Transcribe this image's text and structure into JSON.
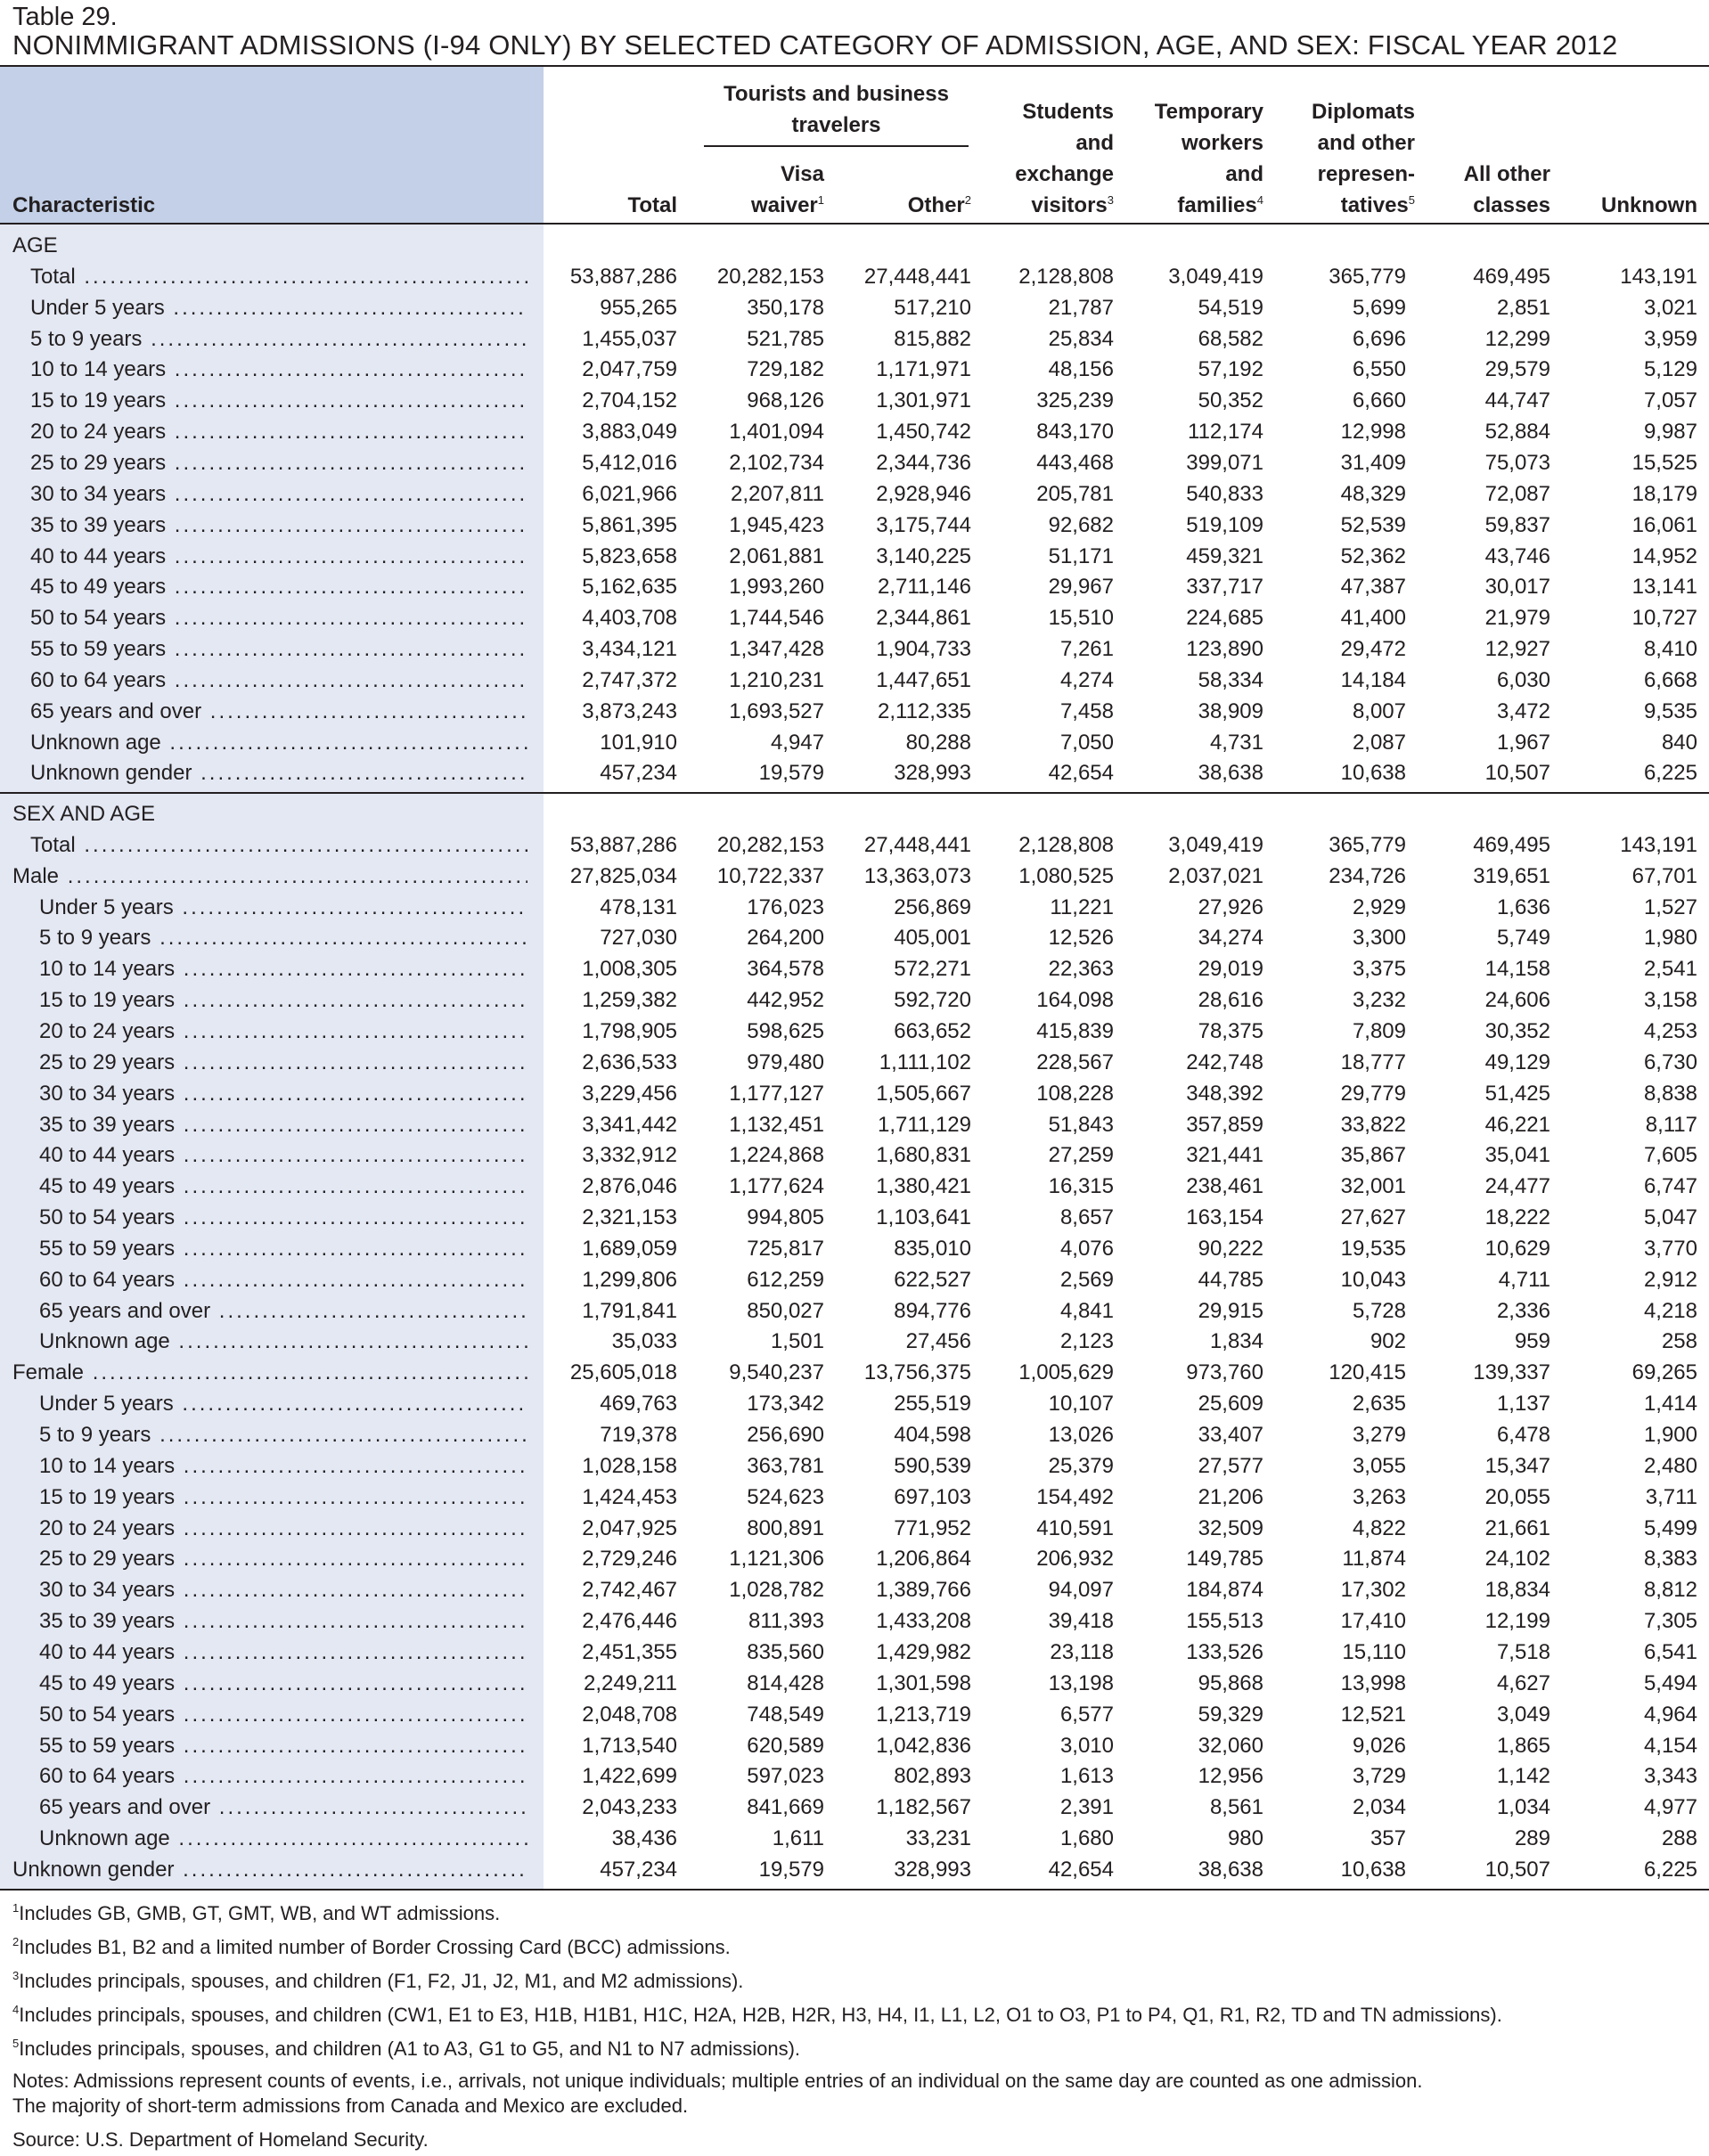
{
  "table_number": "Table 29.",
  "title": "NONIMMIGRANT ADMISSIONS (I-94 ONLY) BY SELECTED CATEGORY OF ADMISSION, AGE, AND SEX: FISCAL YEAR 2012",
  "header": {
    "characteristic": "Characteristic",
    "total": "Total",
    "tourists_group": [
      "Tourists and business",
      "travelers"
    ],
    "visa_waiver": {
      "line1": "Visa",
      "line2": "waiver",
      "note": "1"
    },
    "other": {
      "line1": "Other",
      "note": "2"
    },
    "students": {
      "lines": [
        "Students",
        "and",
        "exchange"
      ],
      "last": "visitors",
      "note": "3"
    },
    "temp_workers": {
      "lines": [
        "Temporary",
        "workers",
        "and"
      ],
      "last": "families",
      "note": "4"
    },
    "diplomats": {
      "lines": [
        "Diplomats",
        "and other",
        "represen-"
      ],
      "last": "tatives",
      "note": "5"
    },
    "all_other": {
      "lines": [
        "All other",
        "classes"
      ]
    },
    "unknown": "Unknown"
  },
  "rows": [
    {
      "label": "AGE",
      "section": true
    },
    {
      "label": "Total",
      "indent": 1,
      "v": [
        "53,887,286",
        "20,282,153",
        "27,448,441",
        "2,128,808",
        "3,049,419",
        "365,779",
        "469,495",
        "143,191"
      ]
    },
    {
      "label": "Under 5 years",
      "indent": 1,
      "v": [
        "955,265",
        "350,178",
        "517,210",
        "21,787",
        "54,519",
        "5,699",
        "2,851",
        "3,021"
      ]
    },
    {
      "label": "5 to 9 years",
      "indent": 1,
      "v": [
        "1,455,037",
        "521,785",
        "815,882",
        "25,834",
        "68,582",
        "6,696",
        "12,299",
        "3,959"
      ]
    },
    {
      "label": "10 to 14 years",
      "indent": 1,
      "v": [
        "2,047,759",
        "729,182",
        "1,171,971",
        "48,156",
        "57,192",
        "6,550",
        "29,579",
        "5,129"
      ]
    },
    {
      "label": "15 to 19 years",
      "indent": 1,
      "v": [
        "2,704,152",
        "968,126",
        "1,301,971",
        "325,239",
        "50,352",
        "6,660",
        "44,747",
        "7,057"
      ]
    },
    {
      "label": "20 to 24 years",
      "indent": 1,
      "v": [
        "3,883,049",
        "1,401,094",
        "1,450,742",
        "843,170",
        "112,174",
        "12,998",
        "52,884",
        "9,987"
      ]
    },
    {
      "label": "25 to 29 years",
      "indent": 1,
      "v": [
        "5,412,016",
        "2,102,734",
        "2,344,736",
        "443,468",
        "399,071",
        "31,409",
        "75,073",
        "15,525"
      ]
    },
    {
      "label": "30 to 34 years",
      "indent": 1,
      "v": [
        "6,021,966",
        "2,207,811",
        "2,928,946",
        "205,781",
        "540,833",
        "48,329",
        "72,087",
        "18,179"
      ]
    },
    {
      "label": "35 to 39 years",
      "indent": 1,
      "v": [
        "5,861,395",
        "1,945,423",
        "3,175,744",
        "92,682",
        "519,109",
        "52,539",
        "59,837",
        "16,061"
      ]
    },
    {
      "label": "40 to 44 years",
      "indent": 1,
      "v": [
        "5,823,658",
        "2,061,881",
        "3,140,225",
        "51,171",
        "459,321",
        "52,362",
        "43,746",
        "14,952"
      ]
    },
    {
      "label": "45 to 49 years",
      "indent": 1,
      "v": [
        "5,162,635",
        "1,993,260",
        "2,711,146",
        "29,967",
        "337,717",
        "47,387",
        "30,017",
        "13,141"
      ]
    },
    {
      "label": "50 to 54 years",
      "indent": 1,
      "v": [
        "4,403,708",
        "1,744,546",
        "2,344,861",
        "15,510",
        "224,685",
        "41,400",
        "21,979",
        "10,727"
      ]
    },
    {
      "label": "55 to 59 years",
      "indent": 1,
      "v": [
        "3,434,121",
        "1,347,428",
        "1,904,733",
        "7,261",
        "123,890",
        "29,472",
        "12,927",
        "8,410"
      ]
    },
    {
      "label": "60 to 64 years",
      "indent": 1,
      "v": [
        "2,747,372",
        "1,210,231",
        "1,447,651",
        "4,274",
        "58,334",
        "14,184",
        "6,030",
        "6,668"
      ]
    },
    {
      "label": "65 years and over",
      "indent": 1,
      "v": [
        "3,873,243",
        "1,693,527",
        "2,112,335",
        "7,458",
        "38,909",
        "8,007",
        "3,472",
        "9,535"
      ]
    },
    {
      "label": "Unknown age",
      "indent": 1,
      "v": [
        "101,910",
        "4,947",
        "80,288",
        "7,050",
        "4,731",
        "2,087",
        "1,967",
        "840"
      ]
    },
    {
      "label": "Unknown gender",
      "indent": 1,
      "v": [
        "457,234",
        "19,579",
        "328,993",
        "42,654",
        "38,638",
        "10,638",
        "10,507",
        "6,225"
      ]
    },
    {
      "label": "SEX AND AGE",
      "section": true
    },
    {
      "label": "Total",
      "indent": 1,
      "v": [
        "53,887,286",
        "20,282,153",
        "27,448,441",
        "2,128,808",
        "3,049,419",
        "365,779",
        "469,495",
        "143,191"
      ]
    },
    {
      "label": "Male",
      "indent": 0,
      "v": [
        "27,825,034",
        "10,722,337",
        "13,363,073",
        "1,080,525",
        "2,037,021",
        "234,726",
        "319,651",
        "67,701"
      ]
    },
    {
      "label": "Under 5 years",
      "indent": 2,
      "v": [
        "478,131",
        "176,023",
        "256,869",
        "11,221",
        "27,926",
        "2,929",
        "1,636",
        "1,527"
      ]
    },
    {
      "label": "5 to 9 years",
      "indent": 2,
      "v": [
        "727,030",
        "264,200",
        "405,001",
        "12,526",
        "34,274",
        "3,300",
        "5,749",
        "1,980"
      ]
    },
    {
      "label": "10 to 14 years",
      "indent": 2,
      "v": [
        "1,008,305",
        "364,578",
        "572,271",
        "22,363",
        "29,019",
        "3,375",
        "14,158",
        "2,541"
      ]
    },
    {
      "label": "15 to 19 years",
      "indent": 2,
      "v": [
        "1,259,382",
        "442,952",
        "592,720",
        "164,098",
        "28,616",
        "3,232",
        "24,606",
        "3,158"
      ]
    },
    {
      "label": "20 to 24 years",
      "indent": 2,
      "v": [
        "1,798,905",
        "598,625",
        "663,652",
        "415,839",
        "78,375",
        "7,809",
        "30,352",
        "4,253"
      ]
    },
    {
      "label": "25 to 29 years",
      "indent": 2,
      "v": [
        "2,636,533",
        "979,480",
        "1,111,102",
        "228,567",
        "242,748",
        "18,777",
        "49,129",
        "6,730"
      ]
    },
    {
      "label": "30 to 34 years",
      "indent": 2,
      "v": [
        "3,229,456",
        "1,177,127",
        "1,505,667",
        "108,228",
        "348,392",
        "29,779",
        "51,425",
        "8,838"
      ]
    },
    {
      "label": "35 to 39 years",
      "indent": 2,
      "v": [
        "3,341,442",
        "1,132,451",
        "1,711,129",
        "51,843",
        "357,859",
        "33,822",
        "46,221",
        "8,117"
      ]
    },
    {
      "label": "40 to 44 years",
      "indent": 2,
      "v": [
        "3,332,912",
        "1,224,868",
        "1,680,831",
        "27,259",
        "321,441",
        "35,867",
        "35,041",
        "7,605"
      ]
    },
    {
      "label": "45 to 49 years",
      "indent": 2,
      "v": [
        "2,876,046",
        "1,177,624",
        "1,380,421",
        "16,315",
        "238,461",
        "32,001",
        "24,477",
        "6,747"
      ]
    },
    {
      "label": "50 to 54 years",
      "indent": 2,
      "v": [
        "2,321,153",
        "994,805",
        "1,103,641",
        "8,657",
        "163,154",
        "27,627",
        "18,222",
        "5,047"
      ]
    },
    {
      "label": "55 to 59 years",
      "indent": 2,
      "v": [
        "1,689,059",
        "725,817",
        "835,010",
        "4,076",
        "90,222",
        "19,535",
        "10,629",
        "3,770"
      ]
    },
    {
      "label": "60 to 64 years",
      "indent": 2,
      "v": [
        "1,299,806",
        "612,259",
        "622,527",
        "2,569",
        "44,785",
        "10,043",
        "4,711",
        "2,912"
      ]
    },
    {
      "label": "65 years and over",
      "indent": 2,
      "v": [
        "1,791,841",
        "850,027",
        "894,776",
        "4,841",
        "29,915",
        "5,728",
        "2,336",
        "4,218"
      ]
    },
    {
      "label": "Unknown age",
      "indent": 2,
      "v": [
        "35,033",
        "1,501",
        "27,456",
        "2,123",
        "1,834",
        "902",
        "959",
        "258"
      ]
    },
    {
      "label": "Female",
      "indent": 0,
      "v": [
        "25,605,018",
        "9,540,237",
        "13,756,375",
        "1,005,629",
        "973,760",
        "120,415",
        "139,337",
        "69,265"
      ]
    },
    {
      "label": "Under 5 years",
      "indent": 2,
      "v": [
        "469,763",
        "173,342",
        "255,519",
        "10,107",
        "25,609",
        "2,635",
        "1,137",
        "1,414"
      ]
    },
    {
      "label": "5 to 9 years",
      "indent": 2,
      "v": [
        "719,378",
        "256,690",
        "404,598",
        "13,026",
        "33,407",
        "3,279",
        "6,478",
        "1,900"
      ]
    },
    {
      "label": "10 to 14 years",
      "indent": 2,
      "v": [
        "1,028,158",
        "363,781",
        "590,539",
        "25,379",
        "27,577",
        "3,055",
        "15,347",
        "2,480"
      ]
    },
    {
      "label": "15 to 19 years",
      "indent": 2,
      "v": [
        "1,424,453",
        "524,623",
        "697,103",
        "154,492",
        "21,206",
        "3,263",
        "20,055",
        "3,711"
      ]
    },
    {
      "label": "20 to 24 years",
      "indent": 2,
      "v": [
        "2,047,925",
        "800,891",
        "771,952",
        "410,591",
        "32,509",
        "4,822",
        "21,661",
        "5,499"
      ]
    },
    {
      "label": "25 to 29 years",
      "indent": 2,
      "v": [
        "2,729,246",
        "1,121,306",
        "1,206,864",
        "206,932",
        "149,785",
        "11,874",
        "24,102",
        "8,383"
      ]
    },
    {
      "label": "30 to 34 years",
      "indent": 2,
      "v": [
        "2,742,467",
        "1,028,782",
        "1,389,766",
        "94,097",
        "184,874",
        "17,302",
        "18,834",
        "8,812"
      ]
    },
    {
      "label": "35 to 39 years",
      "indent": 2,
      "v": [
        "2,476,446",
        "811,393",
        "1,433,208",
        "39,418",
        "155,513",
        "17,410",
        "12,199",
        "7,305"
      ]
    },
    {
      "label": "40 to 44 years",
      "indent": 2,
      "v": [
        "2,451,355",
        "835,560",
        "1,429,982",
        "23,118",
        "133,526",
        "15,110",
        "7,518",
        "6,541"
      ]
    },
    {
      "label": "45 to 49 years",
      "indent": 2,
      "v": [
        "2,249,211",
        "814,428",
        "1,301,598",
        "13,198",
        "95,868",
        "13,998",
        "4,627",
        "5,494"
      ]
    },
    {
      "label": "50 to 54 years",
      "indent": 2,
      "v": [
        "2,048,708",
        "748,549",
        "1,213,719",
        "6,577",
        "59,329",
        "12,521",
        "3,049",
        "4,964"
      ]
    },
    {
      "label": "55 to 59 years",
      "indent": 2,
      "v": [
        "1,713,540",
        "620,589",
        "1,042,836",
        "3,010",
        "32,060",
        "9,026",
        "1,865",
        "4,154"
      ]
    },
    {
      "label": "60 to 64 years",
      "indent": 2,
      "v": [
        "1,422,699",
        "597,023",
        "802,893",
        "1,613",
        "12,956",
        "3,729",
        "1,142",
        "3,343"
      ]
    },
    {
      "label": "65 years and over",
      "indent": 2,
      "v": [
        "2,043,233",
        "841,669",
        "1,182,567",
        "2,391",
        "8,561",
        "2,034",
        "1,034",
        "4,977"
      ]
    },
    {
      "label": "Unknown age",
      "indent": 2,
      "v": [
        "38,436",
        "1,611",
        "33,231",
        "1,680",
        "980",
        "357",
        "289",
        "288"
      ]
    },
    {
      "label": "Unknown gender",
      "indent": 0,
      "v": [
        "457,234",
        "19,579",
        "328,993",
        "42,654",
        "38,638",
        "10,638",
        "10,507",
        "6,225"
      ]
    }
  ],
  "footnotes": [
    {
      "mark": "1",
      "text": "Includes GB, GMB, GT, GMT, WB, and WT admissions."
    },
    {
      "mark": "2",
      "text": "Includes B1, B2 and a limited number of Border Crossing Card (BCC) admissions."
    },
    {
      "mark": "3",
      "text": "Includes principals, spouses, and children (F1, F2, J1, J2, M1, and M2 admissions)."
    },
    {
      "mark": "4",
      "text": "Includes principals, spouses, and children (CW1, E1 to E3, H1B, H1B1, H1C, H2A, H2B, H2R, H3, H4, I1, L1, L2, O1 to O3, P1 to P4, Q1, R1, R2, TD and TN admissions)."
    },
    {
      "mark": "5",
      "text": "Includes principals, spouses, and children (A1 to A3, G1 to G5, and N1 to N7 admissions)."
    }
  ],
  "notes": [
    "Notes: Admissions represent counts of events, i.e., arrivals, not unique individuals; multiple entries of an individual on the same day are counted as one admission.",
    "The majority of short-term admissions from Canada and Mexico are excluded."
  ],
  "source": "Source: U.S. Department of Homeland Security."
}
